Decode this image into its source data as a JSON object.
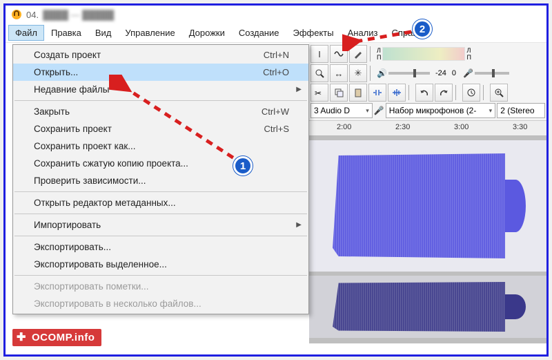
{
  "title_prefix": "04.",
  "menubar": [
    "Файл",
    "Правка",
    "Вид",
    "Управление",
    "Дорожки",
    "Создание",
    "Эффекты",
    "Анализ",
    "Справка"
  ],
  "file_menu": [
    {
      "label": "Создать проект",
      "shortcut": "Ctrl+N",
      "type": "item"
    },
    {
      "label": "Открыть...",
      "shortcut": "Ctrl+O",
      "type": "item",
      "highlight": true
    },
    {
      "label": "Недавние файлы",
      "type": "submenu"
    },
    {
      "type": "sep"
    },
    {
      "label": "Закрыть",
      "shortcut": "Ctrl+W",
      "type": "item"
    },
    {
      "label": "Сохранить проект",
      "shortcut": "Ctrl+S",
      "type": "item"
    },
    {
      "label": "Сохранить проект как...",
      "type": "item"
    },
    {
      "label": "Сохранить сжатую копию проекта...",
      "type": "item"
    },
    {
      "label": "Проверить зависимости...",
      "type": "item"
    },
    {
      "type": "sep"
    },
    {
      "label": "Открыть редактор метаданных...",
      "type": "item"
    },
    {
      "type": "sep"
    },
    {
      "label": "Импортировать",
      "type": "submenu"
    },
    {
      "type": "sep"
    },
    {
      "label": "Экспортировать...",
      "type": "item"
    },
    {
      "label": "Экспортировать выделенное...",
      "type": "item"
    },
    {
      "type": "sep"
    },
    {
      "label": "Экспортировать пометки...",
      "type": "item",
      "disabled": true
    },
    {
      "label": "Экспортировать в несколько файлов...",
      "type": "item",
      "disabled": true
    }
  ],
  "meter_labels": {
    "left": "Л",
    "right": "П"
  },
  "db_value": "-24",
  "db_zero": "0",
  "device_row": {
    "host": "3 Audio D",
    "input": "Набор микрофонов (2-",
    "channels": "2 (Stereo"
  },
  "timeline_ticks": [
    "2:00",
    "2:30",
    "3:00",
    "3:30"
  ],
  "badges": {
    "one": "1",
    "two": "2"
  },
  "watermark": "OCOMP.info"
}
